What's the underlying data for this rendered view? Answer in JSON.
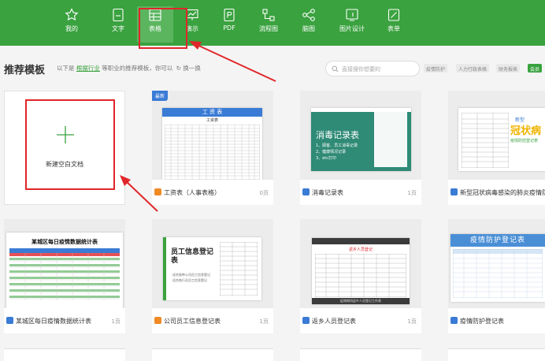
{
  "nav": [
    {
      "label": "我的",
      "icon": "star-icon"
    },
    {
      "label": "文字",
      "icon": "text-doc-icon"
    },
    {
      "label": "表格",
      "icon": "spreadsheet-icon"
    },
    {
      "label": "演示",
      "icon": "presentation-icon"
    },
    {
      "label": "PDF",
      "icon": "pdf-icon"
    },
    {
      "label": "流程图",
      "icon": "flowchart-icon"
    },
    {
      "label": "脑图",
      "icon": "mindmap-icon"
    },
    {
      "label": "图片设计",
      "icon": "image-design-icon"
    },
    {
      "label": "表单",
      "icon": "form-icon"
    }
  ],
  "header": {
    "title": "推荐模板",
    "subtitle_prefix": "以下是",
    "subtitle_link": "根据行业",
    "subtitle_suffix": "等职业的推荐模板，你可以",
    "refresh": "↻ 换一换",
    "search_placeholder": "直接搜你想要的",
    "tags": [
      "疫情防护",
      "人力行政表格",
      "财务报表",
      "会员"
    ]
  },
  "blank_card": {
    "label": "新建空白文档"
  },
  "cards": [
    {
      "caption": "工资表（人事表格）",
      "pages": "0页",
      "badge": "最新",
      "thumb_title": "工 资 表",
      "thumb_sub": "工资表",
      "icon_color": "#f08a24"
    },
    {
      "caption": "消毒记录表",
      "pages": "1页",
      "thumb_title": "消毒记录表",
      "thumb_lines": [
        "1、顾客、员工消毒记录",
        "2、健康情况记录",
        "3、etc打印"
      ],
      "icon_color": "#3a7bd5"
    },
    {
      "caption": "新型冠状病毒感染的肺炎疫情防",
      "pages": "",
      "thumb_title": "新型",
      "thumb_big": "冠状病",
      "thumb_sub": "疫情防控登记表",
      "icon_color": "#3a7bd5"
    },
    {
      "caption": "某城区每日疫情数据统计表",
      "pages": "1页",
      "thumb_title": "某城区每日疫情数据统计表",
      "icon_color": "#3a7bd5"
    },
    {
      "caption": "公司员工信息登记表",
      "pages": "1页",
      "thumb_title": "员工信息登记表",
      "thumb_lines": [
        "适合各种公司员工信息登记",
        "适合各行业员工信息登记"
      ],
      "icon_color": "#f08a24"
    },
    {
      "caption": "返乡人员登记表",
      "pages": "1页",
      "thumb_title": "返乡人员登记",
      "thumb_foot": "疫情期间返乡人员登记工作表",
      "icon_color": "#3a7bd5"
    },
    {
      "caption": "疫情防护登记表",
      "pages": "",
      "thumb_title": "疫情防护登记表",
      "icon_color": "#3a7bd5"
    }
  ],
  "colors": {
    "brand_green": "#3aa23f",
    "annotation_red": "#e0262a",
    "free_blue": "#3a7bd5",
    "premium_orange": "#f08a24"
  }
}
